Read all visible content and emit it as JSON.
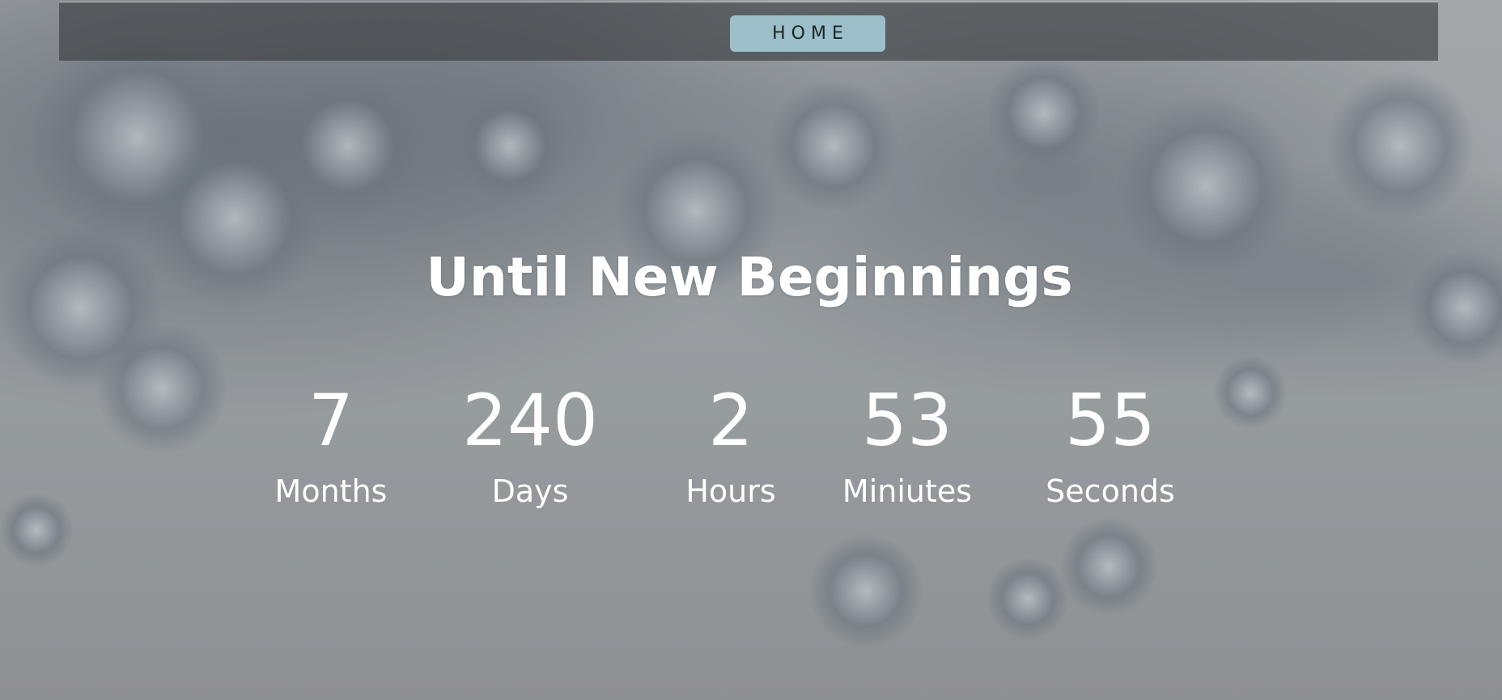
{
  "nav": {
    "home_label": "HOME"
  },
  "hero": {
    "title": "Until New Beginnings"
  },
  "countdown": {
    "units": [
      {
        "value": "7",
        "label": "Months"
      },
      {
        "value": "240",
        "label": "Days"
      },
      {
        "value": "2",
        "label": "Hours"
      },
      {
        "value": "53",
        "label": "Miniutes"
      },
      {
        "value": "55",
        "label": "Seconds"
      }
    ]
  },
  "colors": {
    "nav_button_bg": "#9cbfca",
    "text": "#ffffff",
    "nav_bar": "#373a3e"
  }
}
